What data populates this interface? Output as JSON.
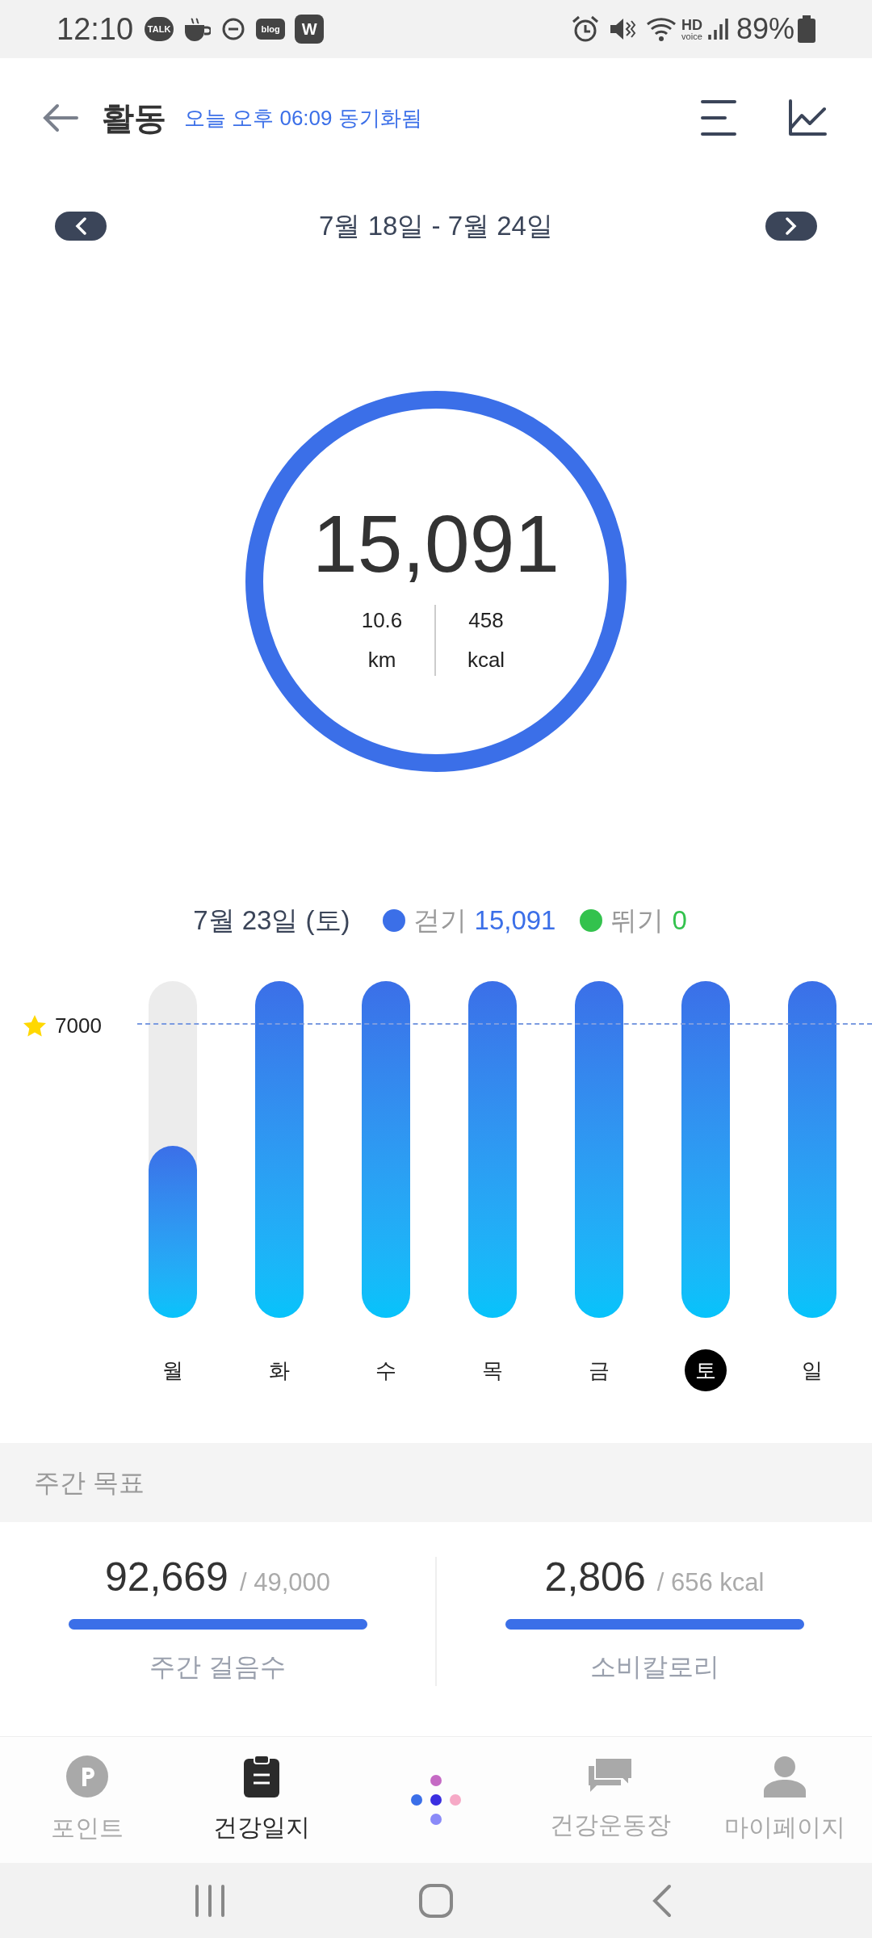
{
  "status_bar": {
    "time": "12:10",
    "talk_icon": "TALK",
    "blog_icon": "blog",
    "w_icon": "W",
    "hd": "HD",
    "voice": "voice",
    "battery": "89%"
  },
  "header": {
    "title": "활동",
    "sync": "오늘 오후 06:09 동기화됨"
  },
  "date_range": "7월 18일 - 7월 24일",
  "ring": {
    "steps": "15,091",
    "distance": "10.6",
    "distance_unit": "km",
    "calories": "458",
    "calories_unit": "kcal"
  },
  "legend": {
    "date": "7월 23일 (토)",
    "items": [
      {
        "label": "걷기",
        "value": "15,091",
        "color": "#3b6fe8"
      },
      {
        "label": "뛰기",
        "value": "0",
        "color": "#33c24d"
      }
    ]
  },
  "goal": "7000",
  "days": [
    {
      "label": "월",
      "selected": false,
      "level": 0.51
    },
    {
      "label": "화",
      "selected": false,
      "level": 1
    },
    {
      "label": "수",
      "selected": false,
      "level": 1
    },
    {
      "label": "목",
      "selected": false,
      "level": 1
    },
    {
      "label": "금",
      "selected": false,
      "level": 1
    },
    {
      "label": "토",
      "selected": true,
      "level": 1
    },
    {
      "label": "일",
      "selected": false,
      "level": 1
    }
  ],
  "weekly_goal": {
    "title": "주간 목표",
    "stats": [
      {
        "value": "92,669",
        "target": "/ 49,000",
        "label": "주간 걸음수",
        "level": 1
      },
      {
        "value": "2,806",
        "target": "/ 656 kcal",
        "label": "소비칼로리",
        "level": 1
      }
    ]
  },
  "bottom_nav": [
    {
      "label": "포인트",
      "selected": false
    },
    {
      "label": "건강일지",
      "selected": true
    },
    {
      "label": "건강운동장",
      "selected": false
    },
    {
      "label": "마이페이지",
      "selected": false
    }
  ]
}
